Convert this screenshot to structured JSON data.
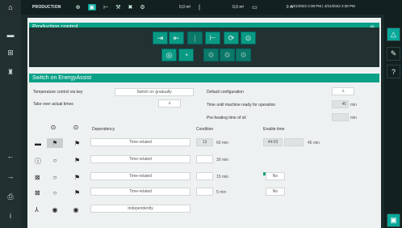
{
  "topbar": {
    "home_icon": "home-icon",
    "title": "PRODUCTION",
    "value1": "0,0 m³",
    "value2": "0,0 m³",
    "value3": "0 m",
    "datetime": "4/21/2022  2:38 PM  |  4/21/2022  2:38 PM"
  },
  "production_control": {
    "header": "Production control",
    "row1_icons": [
      "plate-forward-icon",
      "plate-back-icon",
      "divider-icon",
      "bracket-icon",
      "cycle-icon",
      "stop-icon"
    ],
    "row2_icons": [
      "target-icon",
      "drop-icon",
      "motor-icon",
      "motor2-icon",
      "motor3-icon"
    ]
  },
  "energy_assist": {
    "header": "Switch on EnergyAssist",
    "temp_control_label": "Temperature control via key",
    "temp_control_value": "Switch on gradually",
    "take_over_label": "Take over actual times",
    "default_config_label": "Default configuration",
    "time_until_label": "Time until machine ready for operation",
    "time_until_value": "45",
    "time_until_unit": "min",
    "preheat_label": "Pre-heating time of oil",
    "preheat_unit": "min",
    "col_dependency": "Dependency",
    "col_condition": "Condition",
    "col_enable_time": "Enable time",
    "rows": [
      {
        "dependency": "Time-related",
        "condition_value": "13",
        "condition_unit": "60  min",
        "enable_time": "44:03",
        "enable_unit": "45  min"
      },
      {
        "dependency": "Time-related",
        "condition_unit": "30  min"
      },
      {
        "dependency": "Time-related",
        "condition_unit": "15  min",
        "enable_flag": "No"
      },
      {
        "dependency": "Time-related",
        "condition_unit": "5  min",
        "enable_flag": "No"
      },
      {
        "dependency": "Independently"
      }
    ]
  }
}
